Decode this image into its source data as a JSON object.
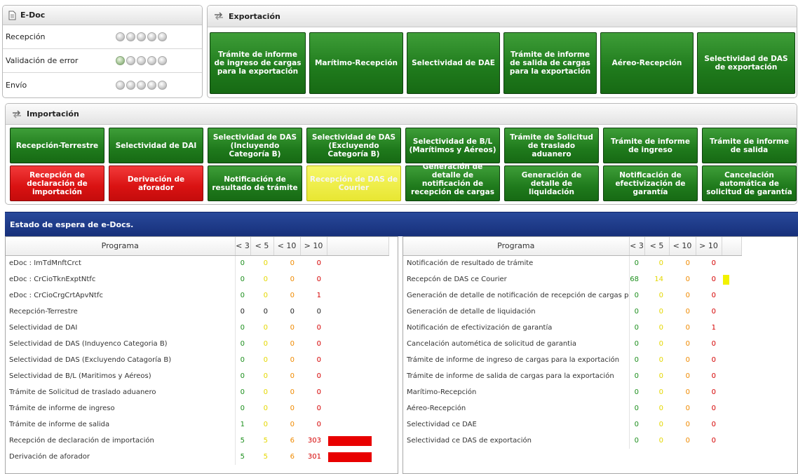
{
  "edoc": {
    "title": "E-Doc",
    "rows": [
      {
        "label": "Recepción",
        "lit": [
          false,
          false,
          false,
          false,
          false
        ]
      },
      {
        "label": "Validación de error",
        "lit": [
          true,
          false,
          false,
          false,
          false
        ]
      },
      {
        "label": "Envío",
        "lit": [
          false,
          false,
          false,
          false,
          false
        ]
      }
    ]
  },
  "export": {
    "title": "Exportación",
    "buttons": [
      {
        "label": "Trámite de informe de ingreso de cargas para la exportación",
        "color": "green"
      },
      {
        "label": "Marítimo-Recepción",
        "color": "green"
      },
      {
        "label": "Selectividad de DAE",
        "color": "green"
      },
      {
        "label": "Trámite de informe de salida de cargas para la exportación",
        "color": "green"
      },
      {
        "label": "Aéreo-Recepción",
        "color": "green"
      },
      {
        "label": "Selectividad de DAS de exportación",
        "color": "green"
      }
    ]
  },
  "import": {
    "title": "Importación",
    "row1": [
      {
        "label": "Recepción-Terrestre",
        "color": "green"
      },
      {
        "label": "Selectividad de DAI",
        "color": "green"
      },
      {
        "label": "Selectividad de DAS (Incluyendo Categoría B)",
        "color": "green"
      },
      {
        "label": "Selectividad de DAS (Excluyendo Categoría B)",
        "color": "green"
      },
      {
        "label": "Selectividad de B/L (Marítimos y Aéreos)",
        "color": "green"
      },
      {
        "label": "Trámite de Solicitud de traslado aduanero",
        "color": "green"
      },
      {
        "label": "Trámite de informe de ingreso",
        "color": "green"
      },
      {
        "label": "Trámite de informe de salida",
        "color": "green"
      }
    ],
    "row2": [
      {
        "label": "Recepción de declaración de importación",
        "color": "red"
      },
      {
        "label": "Derivación de aforador",
        "color": "red"
      },
      {
        "label": "Notificación de resultado de trámite",
        "color": "green"
      },
      {
        "label": "Recepción de DAS de Courier",
        "color": "yellow"
      },
      {
        "label": "Generación de detalle de notificación de recepción de cargas ...",
        "color": "green"
      },
      {
        "label": "Generación de detalle de liquidación",
        "color": "green"
      },
      {
        "label": "Notificación de efectivización de garantía",
        "color": "green"
      },
      {
        "label": "Cancelación automática de solicitud de garantía",
        "color": "green"
      }
    ]
  },
  "waiting": {
    "title": "Estado de espera de e-Docs.",
    "headers": {
      "program": "Programa",
      "lt3": "< 3",
      "lt5": "< 5",
      "lt10": "< 10",
      "gt10": "> 10"
    },
    "colors": {
      "bar_red": "#e80000",
      "bar_yellow": "#f2f200"
    },
    "left": [
      {
        "program": "eDoc : ImTdMnftCrct",
        "lt3": "0",
        "lt5": "0",
        "lt10": "0",
        "gt10": "0",
        "bar": null,
        "lt3c": "c3",
        "lt5c": "c5",
        "lt10c": "c10",
        "gt10c": "g10"
      },
      {
        "program": "eDoc : CrCioTknExptNtfc",
        "lt3": "0",
        "lt5": "0",
        "lt10": "0",
        "gt10": "0",
        "bar": null,
        "lt3c": "c3",
        "lt5c": "c5",
        "lt10c": "c10",
        "gt10c": "g10"
      },
      {
        "program": "eDoc : CrCioCrgCrtApvNtfc",
        "lt3": "0",
        "lt5": "0",
        "lt10": "0",
        "gt10": "1",
        "bar": null,
        "lt3c": "c3",
        "lt5c": "c5",
        "lt10c": "c10",
        "gt10c": "g10"
      },
      {
        "program": "Recepción-Terrestre",
        "lt3": "0",
        "lt5": "0",
        "lt10": "0",
        "gt10": "0",
        "bar": null,
        "lt3c": "",
        "lt5c": "",
        "lt10c": "",
        "gt10c": ""
      },
      {
        "program": "Selectividad de DAI",
        "lt3": "0",
        "lt5": "0",
        "lt10": "0",
        "gt10": "0",
        "bar": null,
        "lt3c": "c3",
        "lt5c": "c5",
        "lt10c": "c10",
        "gt10c": "g10"
      },
      {
        "program": "Selectividad de DAS (Induyenco Categoria B)",
        "lt3": "0",
        "lt5": "0",
        "lt10": "0",
        "gt10": "0",
        "bar": null,
        "lt3c": "c3",
        "lt5c": "c5",
        "lt10c": "c10",
        "gt10c": "g10"
      },
      {
        "program": "Selectividad de DAS (Excluyendo Catagoría B)",
        "lt3": "0",
        "lt5": "0",
        "lt10": "0",
        "gt10": "0",
        "bar": null,
        "lt3c": "c3",
        "lt5c": "c5",
        "lt10c": "c10",
        "gt10c": "g10"
      },
      {
        "program": "Selectividad de B/L (Maritimos y Aéreos)",
        "lt3": "0",
        "lt5": "0",
        "lt10": "0",
        "gt10": "0",
        "bar": null,
        "lt3c": "c3",
        "lt5c": "c5",
        "lt10c": "c10",
        "gt10c": "g10"
      },
      {
        "program": "Trámite de Solicitud de traslado aduanero",
        "lt3": "0",
        "lt5": "0",
        "lt10": "0",
        "gt10": "0",
        "bar": null,
        "lt3c": "c3",
        "lt5c": "c5",
        "lt10c": "c10",
        "gt10c": "g10"
      },
      {
        "program": "Trámite de informe de ingreso",
        "lt3": "0",
        "lt5": "0",
        "lt10": "0",
        "gt10": "0",
        "bar": null,
        "lt3c": "c3",
        "lt5c": "c5",
        "lt10c": "c10",
        "gt10c": "g10"
      },
      {
        "program": "Trámite de informe de salida",
        "lt3": "1",
        "lt5": "0",
        "lt10": "0",
        "gt10": "0",
        "bar": null,
        "lt3c": "c3",
        "lt5c": "c5",
        "lt10c": "c10",
        "gt10c": "g10"
      },
      {
        "program": "Recepción de declaración de importación",
        "lt3": "5",
        "lt5": "5",
        "lt10": "6",
        "gt10": "303",
        "bar": "red",
        "lt3c": "c3",
        "lt5c": "c5",
        "lt10c": "c10",
        "gt10c": "g10"
      },
      {
        "program": "Derivación de aforador",
        "lt3": "5",
        "lt5": "5",
        "lt10": "6",
        "gt10": "301",
        "bar": "red",
        "lt3c": "c3",
        "lt5c": "c5",
        "lt10c": "c10",
        "gt10c": "g10"
      }
    ],
    "right": [
      {
        "program": "Notificación de resultado de trámite",
        "lt3": "0",
        "lt5": "0",
        "lt10": "0",
        "gt10": "0",
        "bar": null
      },
      {
        "program": "Recepcón de DAS ce Courier",
        "lt3": "68",
        "lt5": "14",
        "lt10": "0",
        "gt10": "0",
        "bar": "yellow"
      },
      {
        "program": "Generación de detalle de notificación de recepción de cargas postale",
        "lt3": "0",
        "lt5": "0",
        "lt10": "0",
        "gt10": "0",
        "bar": null
      },
      {
        "program": "Generación de detalle de liquidación",
        "lt3": "0",
        "lt5": "0",
        "lt10": "0",
        "gt10": "0",
        "bar": null
      },
      {
        "program": "Notificación de efectivización de garantía",
        "lt3": "0",
        "lt5": "0",
        "lt10": "0",
        "gt10": "1",
        "bar": null
      },
      {
        "program": "Cancelación automética de solicitud de garantia",
        "lt3": "0",
        "lt5": "0",
        "lt10": "0",
        "gt10": "0",
        "bar": null
      },
      {
        "program": "Trámite de informe de ingreso de cargas para la exportación",
        "lt3": "0",
        "lt5": "0",
        "lt10": "0",
        "gt10": "0",
        "bar": null
      },
      {
        "program": "Trámite de informe de salida de cargas para la exportación",
        "lt3": "0",
        "lt5": "0",
        "lt10": "0",
        "gt10": "0",
        "bar": null
      },
      {
        "program": "Marítimo-Recepción",
        "lt3": "0",
        "lt5": "0",
        "lt10": "0",
        "gt10": "0",
        "bar": null
      },
      {
        "program": "Aéreo-Recepción",
        "lt3": "0",
        "lt5": "0",
        "lt10": "0",
        "gt10": "0",
        "bar": null
      },
      {
        "program": "Selectividad ce DAE",
        "lt3": "0",
        "lt5": "0",
        "lt10": "0",
        "gt10": "0",
        "bar": null
      },
      {
        "program": "Selectividad ce DAS de exportación",
        "lt3": "0",
        "lt5": "0",
        "lt10": "0",
        "gt10": "0",
        "bar": null
      }
    ]
  }
}
